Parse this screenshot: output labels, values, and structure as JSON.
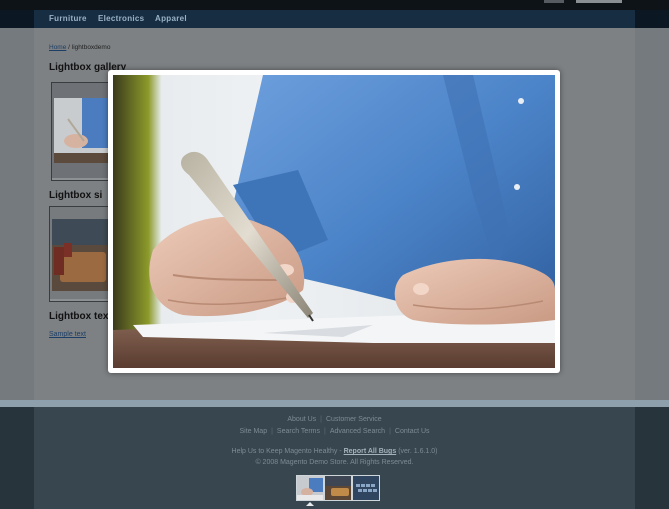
{
  "nav": {
    "items": [
      "Furniture",
      "Electronics",
      "Apparel"
    ]
  },
  "breadcrumb": {
    "home": "Home",
    "separator": "/",
    "current": "lightboxdemo"
  },
  "sections": {
    "gallery_heading": "Lightbox gallery",
    "single_heading": "Lightbox si",
    "text_heading": "Lightbox tex",
    "sample_link": "Sample text"
  },
  "footer": {
    "links_row1": [
      "About Us",
      "Customer Service"
    ],
    "links_row2": [
      "Site Map",
      "Search Terms",
      "Advanced Search",
      "Contact Us"
    ],
    "help_prefix": "Help Us to Keep Magento Healthy -",
    "report_bugs": "Report All Bugs",
    "version": "(ver. 1.6.1.0)",
    "copyright": "© 2008 Magento Demo Store. All Rights Reserved."
  },
  "lightbox": {
    "image_subject": "hand-writing-with-pen-photo"
  },
  "colors": {
    "nav_text": "#9ab2c6",
    "link": "#1d3e66",
    "shirt_blue": "#4a7fc0"
  }
}
